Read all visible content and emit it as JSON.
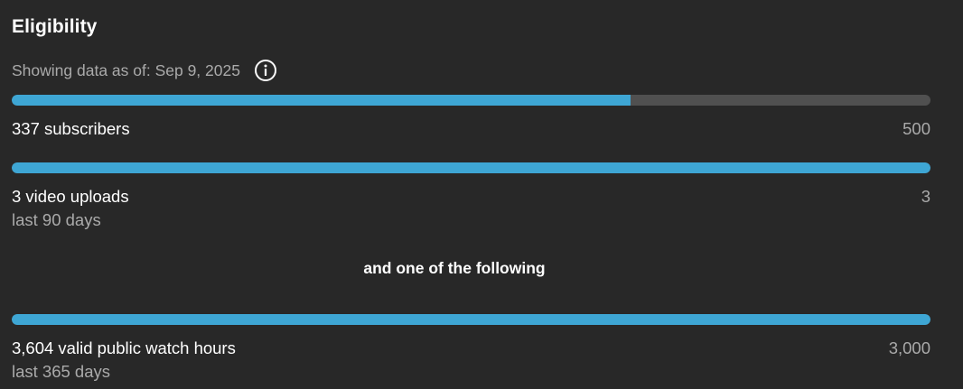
{
  "section": {
    "title": "Eligibility",
    "as_of_text": "Showing data as of: Sep 9, 2025",
    "info_icon": "info-circle-icon"
  },
  "requirements": [
    {
      "label": "337 subscribers",
      "target": "500",
      "sublabel": "",
      "progress_fraction": 0.674
    },
    {
      "label": "3 video uploads",
      "target": "3",
      "sublabel": "last 90 days",
      "progress_fraction": 1.0
    },
    {
      "label": "3,604 valid public watch hours",
      "target": "3,000",
      "sublabel": "last 365 days",
      "progress_fraction": 1.0
    }
  ],
  "divider_text": "and one of the following",
  "colors": {
    "background": "#282828",
    "progress_fill": "#3ea6d4",
    "progress_track": "#505050",
    "secondary_text": "#aaaaaa"
  }
}
